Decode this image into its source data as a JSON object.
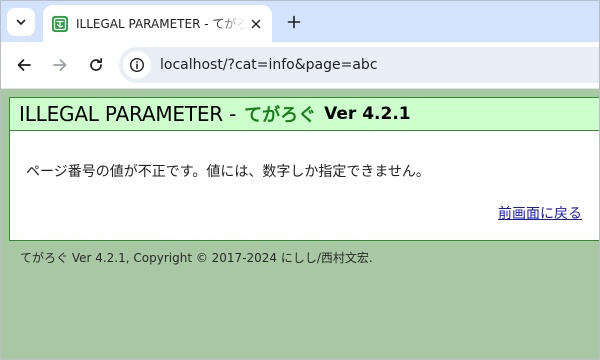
{
  "browser": {
    "tab": {
      "title": "ILLEGAL PARAMETER - てがろぐ Ver 4.2.1",
      "favicon": "tegalog-favicon-icon"
    },
    "url": "localhost/?cat=info&page=abc",
    "icons": {
      "tab_menu": "chevron-down-icon",
      "close": "close-icon",
      "new_tab": "plus-icon",
      "back": "arrow-left-icon",
      "forward": "arrow-right-icon",
      "reload": "reload-icon",
      "site_info": "site-info-icon"
    },
    "colors": {
      "tabstrip": "#d3e3fd",
      "omnibox": "#e9eef6"
    }
  },
  "page": {
    "header": {
      "error_title": "ILLEGAL PARAMETER -",
      "app_name": "てがろぐ",
      "version": "Ver 4.2.1"
    },
    "message": "ページ番号の値が不正です。値には、数字しか指定できません。",
    "back_link": "前画面に戻る",
    "footer": {
      "text": "てがろぐ Ver 4.2.1, Copyright © 2017-2024 ",
      "author": "にしし/西村文宏",
      "suffix": "."
    },
    "colors": {
      "background": "#a8c8a4",
      "header_bg": "#ccffcc",
      "border": "#2f8f2f",
      "app_name": "#1a7f1a",
      "link": "#1a1ab8"
    }
  }
}
